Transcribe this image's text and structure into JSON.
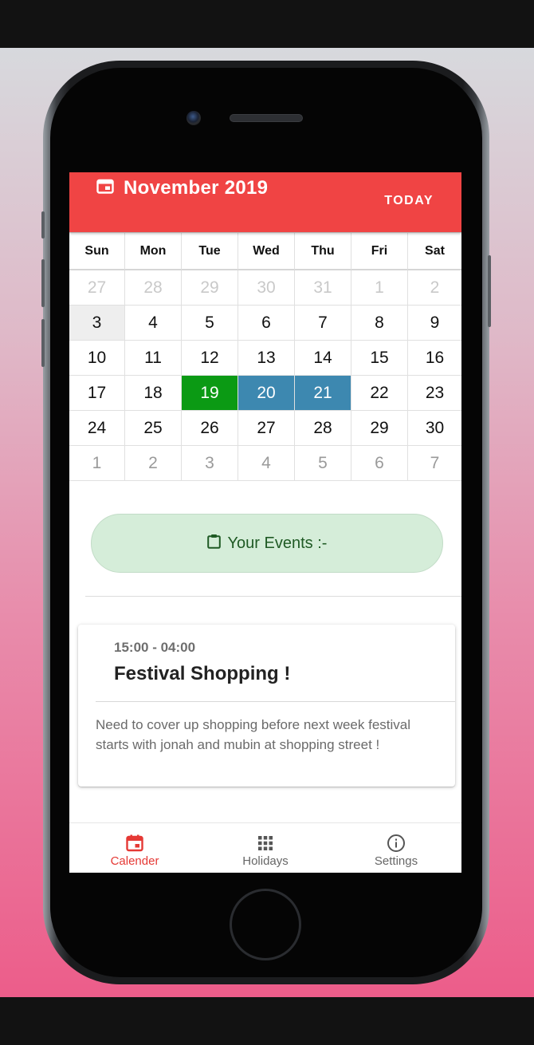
{
  "header": {
    "month_title": "November 2019",
    "today_label": "TODAY"
  },
  "calendar": {
    "weekdays": [
      "Sun",
      "Mon",
      "Tue",
      "Wed",
      "Thu",
      "Fri",
      "Sat"
    ],
    "weeks": [
      [
        "27",
        "28",
        "29",
        "30",
        "31",
        "1",
        "2"
      ],
      [
        "3",
        "4",
        "5",
        "6",
        "7",
        "8",
        "9"
      ],
      [
        "10",
        "11",
        "12",
        "13",
        "14",
        "15",
        "16"
      ],
      [
        "17",
        "18",
        "19",
        "20",
        "21",
        "22",
        "23"
      ],
      [
        "24",
        "25",
        "26",
        "27",
        "28",
        "29",
        "30"
      ],
      [
        "1",
        "2",
        "3",
        "4",
        "5",
        "6",
        "7"
      ]
    ],
    "highlight_colors": {
      "today": "#eeeeee",
      "selected": "#0b9a14",
      "event": "#3d88b0"
    }
  },
  "events_section": {
    "label": "Your Events :-"
  },
  "event": {
    "time": "15:00 - 04:00",
    "title": "Festival Shopping !",
    "description": "Need to cover up shopping before next week festival starts with jonah and mubin at shopping street !"
  },
  "bottom_nav": {
    "items": [
      {
        "label": "Calender",
        "icon": "calendar-icon",
        "active": true
      },
      {
        "label": "Holidays",
        "icon": "grid-icon",
        "active": false
      },
      {
        "label": "Settings",
        "icon": "info-icon",
        "active": false
      }
    ]
  },
  "theme": {
    "accent": "#f04444",
    "active_nav": "#e53935"
  }
}
